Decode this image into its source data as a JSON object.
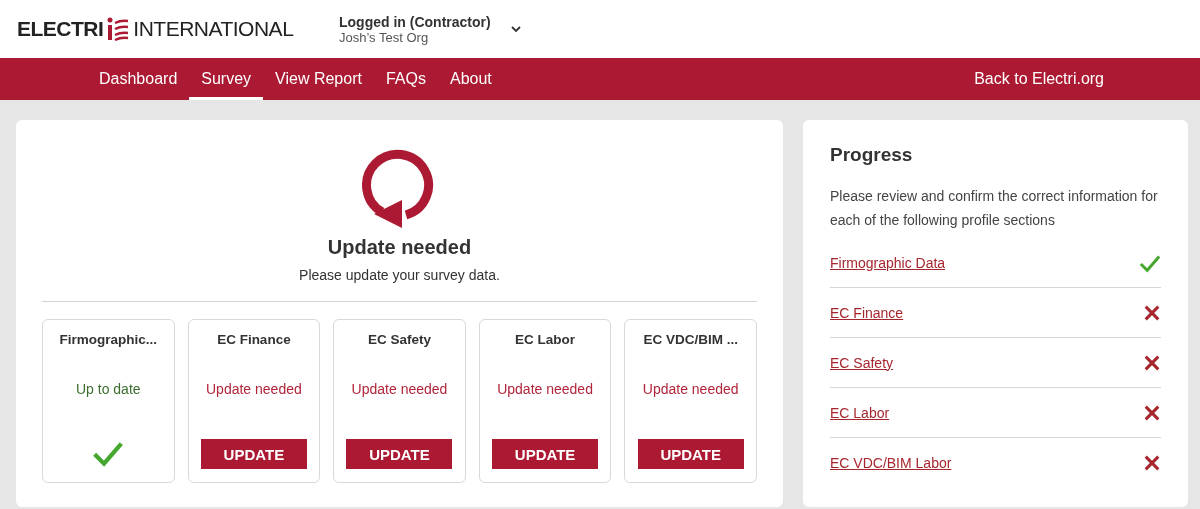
{
  "header": {
    "logo_left": "ELECTRI",
    "logo_right": "INTERNATIONAL",
    "account": {
      "role": "Logged in (Contractor)",
      "org": "Josh’s Test Org"
    }
  },
  "nav": {
    "items": [
      {
        "label": "Dashboard",
        "selected": false
      },
      {
        "label": "Survey",
        "selected": true
      },
      {
        "label": "View Report",
        "selected": false
      },
      {
        "label": "FAQs",
        "selected": false
      },
      {
        "label": "About",
        "selected": false
      }
    ],
    "right_link": "Back to Electri.org"
  },
  "survey": {
    "title": "Update needed",
    "subtitle": "Please update your survey data.",
    "sections": [
      {
        "title": "Firmographic...",
        "status": "Up to date",
        "complete": true
      },
      {
        "title": "EC Finance",
        "status": "Update needed",
        "complete": false,
        "button": "UPDATE"
      },
      {
        "title": "EC Safety",
        "status": "Update needed",
        "complete": false,
        "button": "UPDATE"
      },
      {
        "title": "EC Labor",
        "status": "Update needed",
        "complete": false,
        "button": "UPDATE"
      },
      {
        "title": "EC VDC/BIM ...",
        "status": "Update needed",
        "complete": false,
        "button": "UPDATE"
      }
    ]
  },
  "progress": {
    "title": "Progress",
    "description": "Please review and confirm the correct information for each of the following profile sections",
    "items": [
      {
        "label": "Firmographic Data",
        "complete": true
      },
      {
        "label": "EC Finance",
        "complete": false
      },
      {
        "label": "EC Safety",
        "complete": false
      },
      {
        "label": "EC Labor",
        "complete": false
      },
      {
        "label": "EC VDC/BIM Labor",
        "complete": false
      }
    ]
  }
}
